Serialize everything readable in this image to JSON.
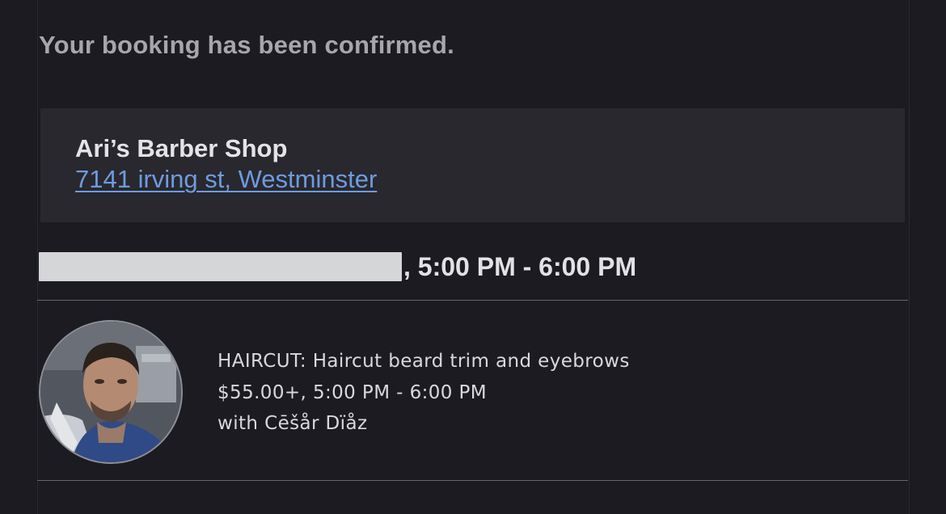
{
  "confirmation": {
    "message": "Your booking has been confirmed."
  },
  "shop": {
    "name": "Ari’s Barber Shop",
    "address": "7141 irving st, Westminster"
  },
  "appointment": {
    "date_redacted": true,
    "time_text": ", 5:00 PM - 6:00 PM"
  },
  "service": {
    "title": "HAIRCUT: Haircut beard trim and eyebrows",
    "price_time": "$55.00+, 5:00 PM - 6:00 PM",
    "staff": "with Cēšår Dïåz"
  },
  "colors": {
    "background": "#1c1b21",
    "card": "#28282e",
    "link": "#6f9be0",
    "heading": "#a6a6ab",
    "text": "#e2e2e5"
  },
  "icons": {
    "avatar": "staff-avatar-photo"
  }
}
